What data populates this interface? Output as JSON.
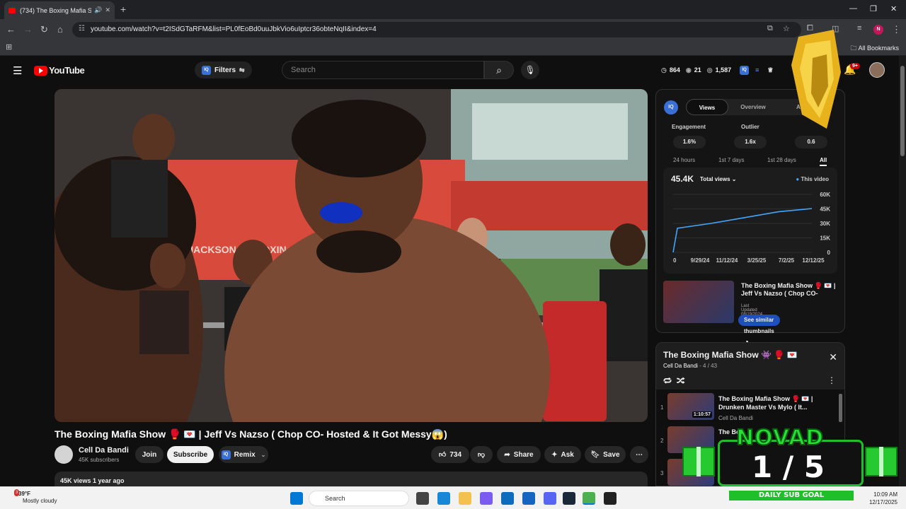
{
  "browser": {
    "tab_title": "(734) The Boxing Mafia Show",
    "url": "youtube.com/watch?v=t2ISdGTaRFM&list=PL0fEoBd0uuJbkVio6uIptcr36obteNqII&index=4",
    "bookmarks_label": "All Bookmarks",
    "profile_initial": "N"
  },
  "yt": {
    "logo": "YouTube",
    "filters_label": "Filters",
    "search_placeholder": "Search",
    "stats": [
      "864",
      "21",
      "1,587"
    ],
    "notif_badge": "9+"
  },
  "video": {
    "title": "The Boxing Mafia Show 🥊 💌 | Jeff Vs Nazso ( Chop CO- Hosted & It Got Messy😱)",
    "channel": "Cell Da Bandi",
    "subs": "45K subscribers",
    "join": "Join",
    "subscribe": "Subscribe",
    "remix": "Remix",
    "likes": "734",
    "share": "Share",
    "ask": "Ask",
    "save": "Save",
    "views_line": "45K views  1 year ago"
  },
  "iq": {
    "logo": "IQ",
    "tabs": [
      "Views",
      "Overview",
      "AI"
    ],
    "metrics": [
      {
        "label": "Engagement",
        "value": "1.6%"
      },
      {
        "label": "Outlier",
        "value": "1.6x"
      },
      {
        "label": "",
        "value": "0.6"
      }
    ],
    "ranges": [
      "24 hours",
      "1st 7 days",
      "1st 28 days",
      "All"
    ],
    "total": "45.4K",
    "total_sel": "Total views",
    "legend": "This video",
    "similar_title": "The Boxing Mafia Show 🥊 💌 | Jeff Vs Nazso ( Chop CO-",
    "updated": "Last Updated 08/19/2024",
    "similar_btn": "See similar thumbnails ↗"
  },
  "chart_data": {
    "type": "line",
    "x": [
      "9/29/24",
      "11/12/24",
      "3/25/25",
      "7/2/25",
      "12/12/25"
    ],
    "yticks": [
      "0",
      "15K",
      "30K",
      "45K",
      "60K"
    ],
    "ylim": [
      0,
      60000
    ],
    "series": [
      {
        "name": "This video",
        "values": [
          0,
          25000,
          30000,
          36000,
          42000,
          45400
        ]
      }
    ],
    "first_x_label": "0"
  },
  "playlist": {
    "title": "The Boxing Mafia Show 👾 🥊 💌",
    "channel": "Cell Da Bandi",
    "position": " - 4 / 43",
    "items": [
      {
        "num": "1",
        "title": "The Boxing Mafia Show 🥊 💌 | Drunken Master Vs Mylo ( It...",
        "channel": "Cell Da Bandi",
        "duration": "1:10:57"
      },
      {
        "num": "2",
        "title": "The Bo...",
        "channel": "",
        "duration": ""
      },
      {
        "num": "3",
        "title": "",
        "channel": "",
        "duration": ""
      }
    ]
  },
  "goal": {
    "name": "NOVAD",
    "count": "1 / 5",
    "label": "DAILY SUB GOAL"
  },
  "taskbar": {
    "weather_badge": "3",
    "temp": "39°F",
    "cond": "Mostly cloudy",
    "search": "Search",
    "time": "10:09 AM",
    "date": "12/17/2025"
  }
}
